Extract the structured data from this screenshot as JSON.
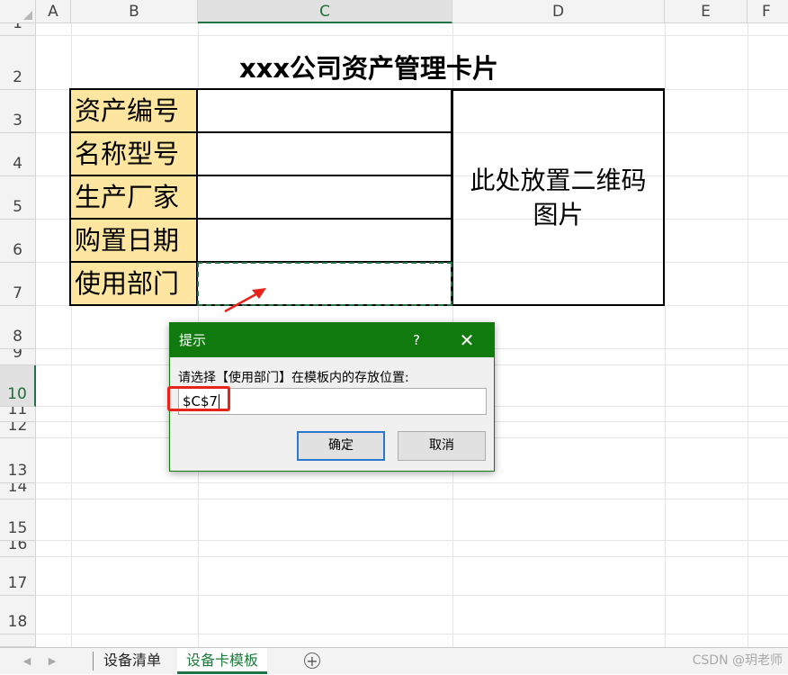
{
  "columns": [
    "A",
    "B",
    "C",
    "D",
    "E",
    "F"
  ],
  "rows": [
    "1",
    "2",
    "3",
    "4",
    "5",
    "6",
    "7",
    "8",
    "9",
    "10",
    "11",
    "12",
    "13",
    "14",
    "15",
    "16",
    "17",
    "18"
  ],
  "sheet": {
    "title": "xxx公司资产管理卡片",
    "labels": [
      "资产编号",
      "名称型号",
      "生产厂家",
      "购置日期",
      "使用部门"
    ],
    "qr_placeholder": "此处放置二维码图片"
  },
  "dialog": {
    "title": "提示",
    "help": "?",
    "close": "✕",
    "prompt": "请选择【使用部门】在模板内的存放位置:",
    "input_value": "$C$7",
    "ok_label": "确定",
    "cancel_label": "取消"
  },
  "tabs": {
    "prev": "◀",
    "next": "▶",
    "items": [
      "设备清单",
      "设备卡模板"
    ],
    "active": "设备卡模板",
    "add": "+"
  },
  "watermark": "CSDN @玥老师",
  "colors": {
    "excel_green": "#217346",
    "dialog_title": "#117a0f",
    "label_fill": "#ffe6a0",
    "highlight_red": "#e8231c"
  }
}
